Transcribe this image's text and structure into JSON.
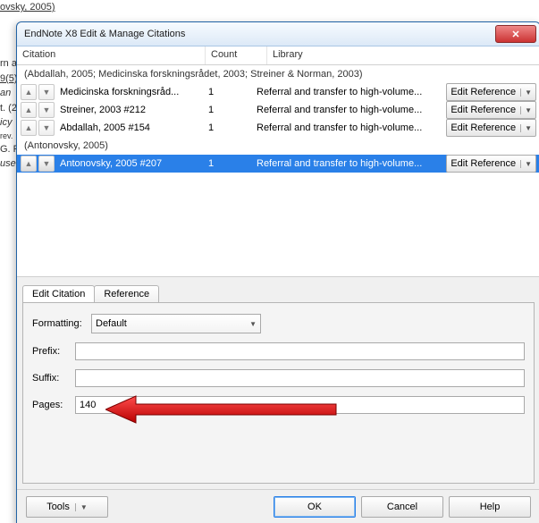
{
  "bg": {
    "l1": "ovsky, 2005)",
    "l2": "rn a",
    "l3": "9(5).",
    "l4": "an",
    "l5": "t. (2",
    "l6": "icy",
    "l7": "rev.",
    "l8": "G. R",
    "l9": "use"
  },
  "window": {
    "title": "EndNote X8 Edit & Manage Citations"
  },
  "columns": {
    "citation": "Citation",
    "count": "Count",
    "library": "Library"
  },
  "groups": [
    {
      "label": "(Abdallah, 2005; Medicinska forskningsrådet, 2003; Streiner & Norman, 2003)",
      "rows": [
        {
          "citation": "Medicinska forskningsråd...",
          "count": "1",
          "library": "Referral and transfer to high-volume...",
          "edit": "Edit Reference"
        },
        {
          "citation": "Streiner, 2003 #212",
          "count": "1",
          "library": "Referral and transfer to high-volume...",
          "edit": "Edit Reference"
        },
        {
          "citation": "Abdallah, 2005 #154",
          "count": "1",
          "library": "Referral and transfer to high-volume...",
          "edit": "Edit Reference"
        }
      ]
    },
    {
      "label": "(Antonovsky, 2005)",
      "rows": [
        {
          "citation": "Antonovsky, 2005 #207",
          "count": "1",
          "library": "Referral and transfer to high-volume...",
          "edit": "Edit Reference",
          "selected": true
        }
      ]
    }
  ],
  "tabs": {
    "edit": "Edit Citation",
    "reference": "Reference"
  },
  "form": {
    "formatting_label": "Formatting:",
    "formatting_value": "Default",
    "prefix_label": "Prefix:",
    "prefix_value": "",
    "suffix_label": "Suffix:",
    "suffix_value": "",
    "pages_label": "Pages:",
    "pages_value": "140"
  },
  "buttons": {
    "tools": "Tools",
    "ok": "OK",
    "cancel": "Cancel",
    "help": "Help"
  }
}
